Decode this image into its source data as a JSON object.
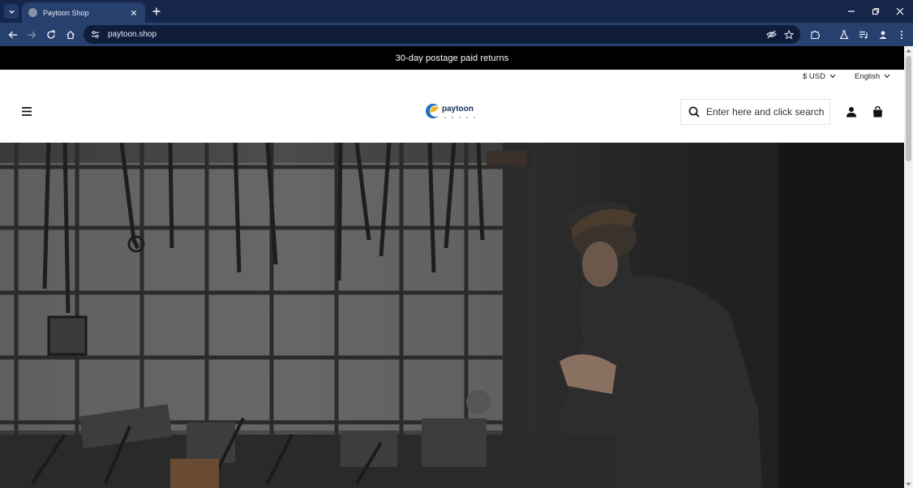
{
  "browser": {
    "tab_title": "Paytoon Shop",
    "url": "paytoon.shop"
  },
  "page": {
    "announcement": "30-day postage paid returns",
    "currency": "$ USD",
    "language": "English",
    "search_placeholder": "Enter here and click search",
    "logo_text": "paytoon"
  },
  "icons": {
    "tab_menu": "chevron-down-icon",
    "close": "close-icon",
    "new_tab": "plus-icon",
    "back": "back-arrow-icon",
    "forward": "forward-arrow-icon",
    "reload": "reload-icon",
    "home": "home-icon",
    "site_info": "tune-icon",
    "eye_off": "eye-off-icon",
    "bookmark": "star-icon",
    "extensions": "puzzle-icon",
    "labs": "flask-icon",
    "media": "queue-music-icon",
    "profile": "person-icon",
    "more": "kebab-icon",
    "menu": "hamburger-icon",
    "search": "search-icon",
    "account": "user-icon",
    "cart": "bag-icon"
  },
  "colors": {
    "tabstrip": "#16264a",
    "toolbar": "#27406d",
    "announcement_bg": "#000000",
    "logo_blue": "#1d6fb8",
    "logo_yellow": "#f2b51b"
  }
}
